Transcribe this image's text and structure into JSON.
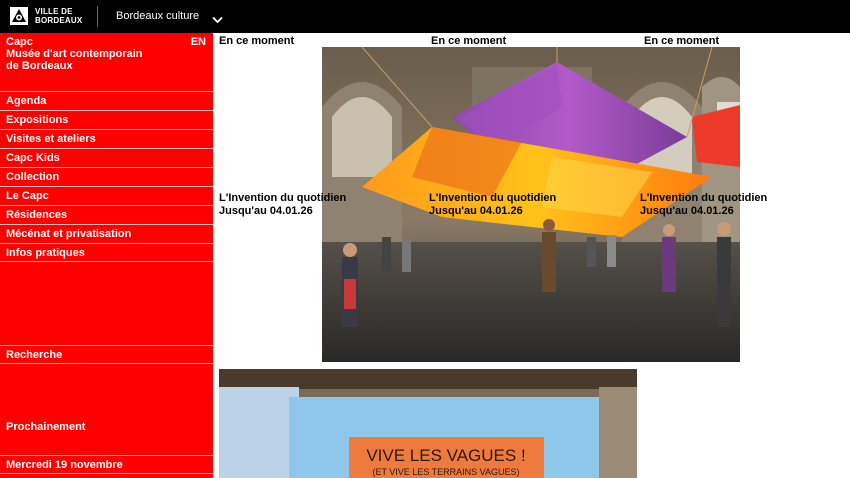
{
  "topbar": {
    "logo_line1": "VILLE DE",
    "logo_line2": "BORDEAUX",
    "menu_label": "Bordeaux culture"
  },
  "sidebar": {
    "brand_line1": "Capc",
    "brand_line2": "Musée d'art contemporain",
    "brand_line3": "de Bordeaux",
    "lang": "EN",
    "items": [
      {
        "label": "Agenda"
      },
      {
        "label": "Expositions"
      },
      {
        "label": "Visites et ateliers"
      },
      {
        "label": "Capc Kids"
      },
      {
        "label": "Collection"
      },
      {
        "label": "Le Capc"
      },
      {
        "label": "Résidences"
      },
      {
        "label": "Mécénat et privatisation"
      },
      {
        "label": "Infos pratiques"
      }
    ],
    "search": "Recherche",
    "upcoming": "Prochainement",
    "date": "Mercredi 19 novembre"
  },
  "main": {
    "columns": [
      {
        "label": "En ce moment",
        "title": "L'Invention du quotidien",
        "dates": "Jusqu'au 04.01.26"
      },
      {
        "label": "En ce moment",
        "title": "L'Invention du quotidien",
        "dates": "Jusqu'au 04.01.26"
      },
      {
        "label": "En ce moment",
        "title": "L'Invention du quotidien",
        "dates": "Jusqu'au 04.01.26"
      }
    ],
    "banner_line1": "VIVE LES VAGUES !",
    "banner_line2": "(ET VIVE LES TERRAINS VAGUES)"
  },
  "colors": {
    "brand_red": "#ff0000",
    "topbar_black": "#000000"
  }
}
